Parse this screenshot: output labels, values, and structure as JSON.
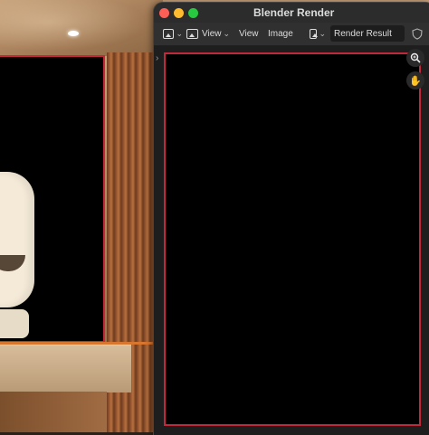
{
  "window": {
    "title": "Blender Render"
  },
  "header": {
    "editor_type_icon": "image-editor-icon",
    "view_mode_label": "View",
    "menus": [
      "View",
      "Image"
    ],
    "image_icon": "image-browse-icon",
    "image_name": "Render Result"
  },
  "colors": {
    "render_border": "#c0283c",
    "close": "#ff5f57",
    "minimize": "#febc2e",
    "maximize": "#28c840"
  }
}
